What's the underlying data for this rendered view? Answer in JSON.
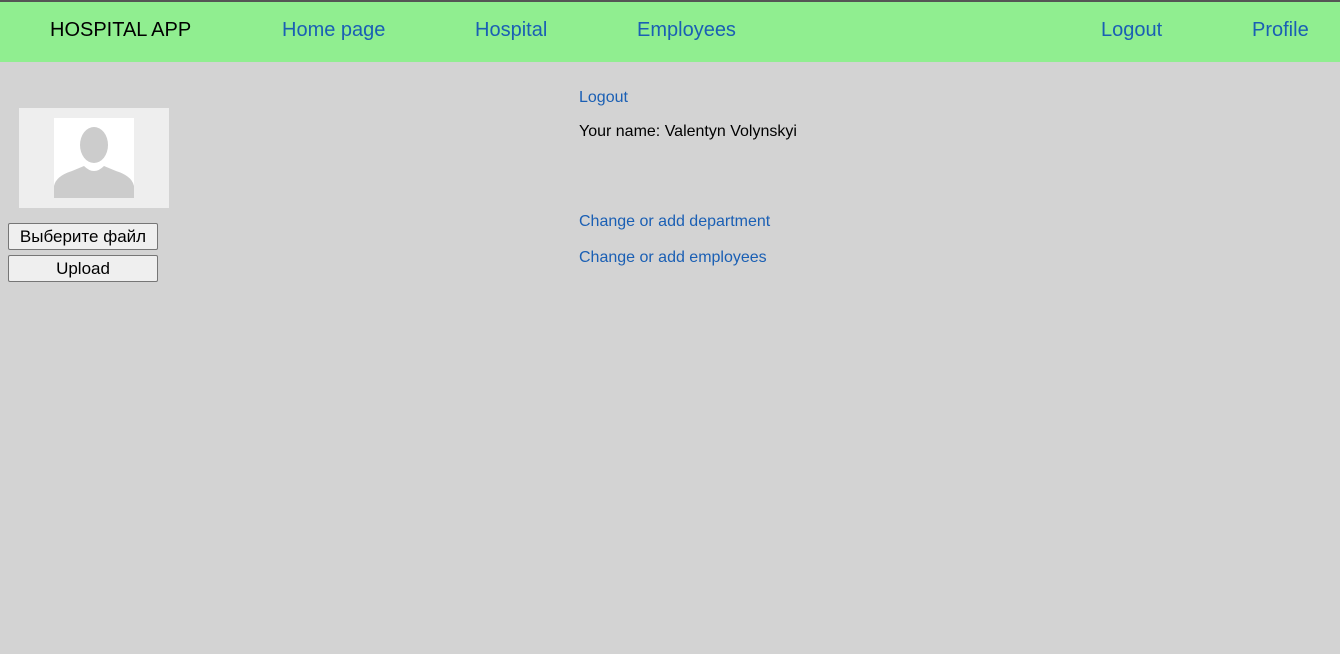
{
  "navbar": {
    "brand": "HOSPITAL APP",
    "links": {
      "home": "Home page",
      "hospital": "Hospital",
      "employees": "Employees",
      "logout": "Logout",
      "profile": "Profile"
    }
  },
  "profile": {
    "choose_file_label": "Выберите файл",
    "upload_label": "Upload"
  },
  "content": {
    "logout_link": "Logout",
    "your_name": "Your name: Valentyn Volynskyi",
    "change_department": "Change or add department",
    "change_employees": "Change or add employees"
  },
  "colors": {
    "navbar_bg": "#90ee90",
    "page_bg": "#d3d3d3",
    "link": "#1a5fb4"
  }
}
